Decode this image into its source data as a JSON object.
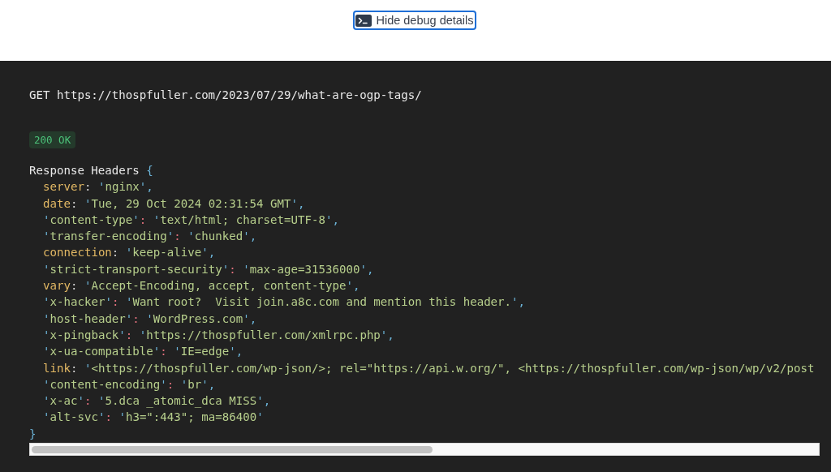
{
  "toggle_button": {
    "label": "Hide debug details"
  },
  "request": {
    "method": "GET",
    "url": "https://thospfuller.com/2023/07/29/what-are-ogp-tags/"
  },
  "status": {
    "text": "200 OK"
  },
  "headers": {
    "title": "Response Headers",
    "open_brace": "{",
    "close_brace": "}",
    "entries": [
      {
        "kind": "identifier",
        "key": "server",
        "colon": ":",
        "value": "'nginx'",
        "comma": ","
      },
      {
        "kind": "identifier",
        "key": "date",
        "colon": ":",
        "value": "'Tue, 29 Oct 2024 02:31:54 GMT'",
        "comma": ","
      },
      {
        "kind": "string",
        "key": "'content-type'",
        "colon": ":",
        "value": "'text/html; charset=UTF-8'",
        "comma": ","
      },
      {
        "kind": "string",
        "key": "'transfer-encoding'",
        "colon": ":",
        "value": "'chunked'",
        "comma": ","
      },
      {
        "kind": "identifier",
        "key": "connection",
        "colon": ":",
        "value": "'keep-alive'",
        "comma": ","
      },
      {
        "kind": "string",
        "key": "'strict-transport-security'",
        "colon": ":",
        "value": "'max-age=31536000'",
        "comma": ","
      },
      {
        "kind": "identifier",
        "key": "vary",
        "colon": ":",
        "value": "'Accept-Encoding, accept, content-type'",
        "comma": ","
      },
      {
        "kind": "string",
        "key": "'x-hacker'",
        "colon": ":",
        "value": "'Want root?  Visit join.a8c.com and mention this header.'",
        "comma": ","
      },
      {
        "kind": "string",
        "key": "'host-header'",
        "colon": ":",
        "value": "'WordPress.com'",
        "comma": ","
      },
      {
        "kind": "string",
        "key": "'x-pingback'",
        "colon": ":",
        "value": "'https://thospfuller.com/xmlrpc.php'",
        "comma": ","
      },
      {
        "kind": "string",
        "key": "'x-ua-compatible'",
        "colon": ":",
        "value": "'IE=edge'",
        "comma": ","
      },
      {
        "kind": "identifier",
        "key": "link",
        "colon": ":",
        "value": "'<https://thospfuller.com/wp-json/>; rel=\"https://api.w.org/\", <https://thospfuller.com/wp-json/wp/v2/post"
      },
      {
        "kind": "string",
        "key": "'content-encoding'",
        "colon": ":",
        "value": "'br'",
        "comma": ","
      },
      {
        "kind": "string",
        "key": "'x-ac'",
        "colon": ":",
        "value": "'5.dca _atomic_dca MISS'",
        "comma": ","
      },
      {
        "kind": "string",
        "key": "'alt-svc'",
        "colon": ":",
        "value": "'h3=\":443\"; ma=86400'"
      }
    ]
  }
}
